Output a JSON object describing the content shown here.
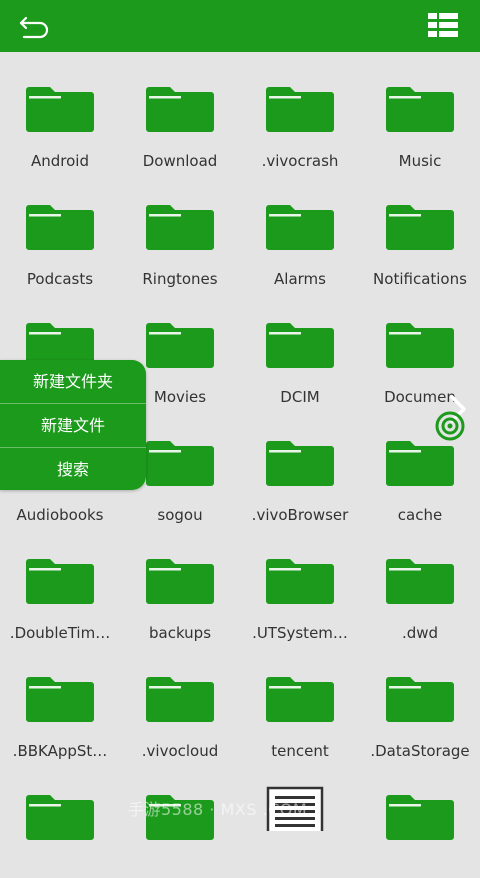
{
  "colors": {
    "accent": "#1c9a1c",
    "background": "#e4e4e4",
    "label": "#333333"
  },
  "header": {
    "back_icon": "back-arrow-icon",
    "view_icon": "grid-view-icon"
  },
  "folders": [
    {
      "label": "Android"
    },
    {
      "label": "Download"
    },
    {
      "label": ".vivocrash"
    },
    {
      "label": "Music"
    },
    {
      "label": "Podcasts"
    },
    {
      "label": "Ringtones"
    },
    {
      "label": "Alarms"
    },
    {
      "label": "Notifications"
    },
    {
      "label": ""
    },
    {
      "label": "Movies"
    },
    {
      "label": "DCIM"
    },
    {
      "label": "Documen"
    },
    {
      "label": "Audiobooks"
    },
    {
      "label": "sogou"
    },
    {
      "label": ".vivoBrowser"
    },
    {
      "label": "cache"
    },
    {
      "label": ".DoubleTim…"
    },
    {
      "label": "backups"
    },
    {
      "label": ".UTSystem…"
    },
    {
      "label": ".dwd"
    },
    {
      "label": ".BBKAppSt…"
    },
    {
      "label": ".vivocloud"
    },
    {
      "label": "tencent"
    },
    {
      "label": ".DataStorage"
    }
  ],
  "context_menu": {
    "items": [
      {
        "label": "新建文件夹"
      },
      {
        "label": "新建文件"
      },
      {
        "label": "搜索"
      }
    ]
  },
  "watermark": "手游5588 · MXS   .COM"
}
